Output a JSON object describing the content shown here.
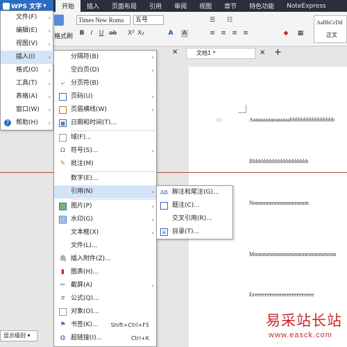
{
  "app": {
    "title": "WPS 文字",
    "tabs": [
      "开始",
      "插入",
      "页面布局",
      "引用",
      "审阅",
      "视图",
      "章节",
      "特色功能",
      "NoteExpress"
    ]
  },
  "ribbon": {
    "format_painter": "格式刷",
    "font_name": "Times New Roma",
    "font_size": "五号",
    "style_sample": "AaBbCcDd",
    "style_name": "正文"
  },
  "document": {
    "tab_title": "文档1 *",
    "lines": [
      "Aaaaaaaaaaaaaaaabbbbbbbbbbbbbbbb",
      "Bbbbbbbbbbbbbbbbbbbbb",
      "Nnnnnnnnnnnnnnnnnnnnn",
      "Mmmmmmmmmmmmmmmmmmmm",
      "Eeeeeeeeeeeeeeeeeeeeeeeeee"
    ]
  },
  "status": {
    "outline_level": "显示级别"
  },
  "menu_main": [
    {
      "label": "文件(F)",
      "arrow": "›"
    },
    {
      "label": "编辑(E)",
      "arrow": "›"
    },
    {
      "label": "视图(V)",
      "arrow": "›"
    },
    {
      "label": "插入(I)",
      "arrow": "›"
    },
    {
      "label": "格式(O)",
      "arrow": "›"
    },
    {
      "label": "工具(T)",
      "arrow": "›"
    },
    {
      "label": "表格(A)",
      "arrow": "›"
    },
    {
      "label": "窗口(W)",
      "arrow": "›"
    },
    {
      "label": "帮助(H)",
      "arrow": "›"
    }
  ],
  "menu_insert": [
    {
      "label": "分隔符(B)",
      "arrow": "›"
    },
    {
      "label": "空白页(D)",
      "arrow": "›"
    },
    {
      "label": "分页符(B)"
    },
    {
      "label": "页码(U)",
      "arrow": "›"
    },
    {
      "label": "页眉横线(W)",
      "arrow": "›"
    },
    {
      "label": "日期和时间(T)..."
    },
    {
      "label": "域(F)..."
    },
    {
      "label": "符号(S)...",
      "arrow": "›"
    },
    {
      "label": "批注(M)"
    },
    {
      "label": "数字(E)..."
    },
    {
      "label": "引用(N)",
      "arrow": "›"
    },
    {
      "label": "图片(P)",
      "arrow": "›"
    },
    {
      "label": "水印(G)",
      "arrow": "›"
    },
    {
      "label": "文本框(X)",
      "arrow": "›"
    },
    {
      "label": "文件(L)..."
    },
    {
      "label": "插入附件(Z)..."
    },
    {
      "label": "图表(H)..."
    },
    {
      "label": "截屏(A)",
      "arrow": "›"
    },
    {
      "label": "公式(Q)..."
    },
    {
      "label": "对象(O)..."
    },
    {
      "label": "书签(K)...",
      "shortcut": "Shift+Ctrl+F5"
    },
    {
      "label": "超链接(I)...",
      "shortcut": "Ctrl+K"
    }
  ],
  "menu_reference": [
    {
      "label": "脚注和尾注(G)..."
    },
    {
      "label": "题注(C)..."
    },
    {
      "label": "交叉引用(R)..."
    },
    {
      "label": "目录(T)..."
    }
  ],
  "watermark": {
    "text": "易采站长站",
    "url": "www.easck.com"
  }
}
